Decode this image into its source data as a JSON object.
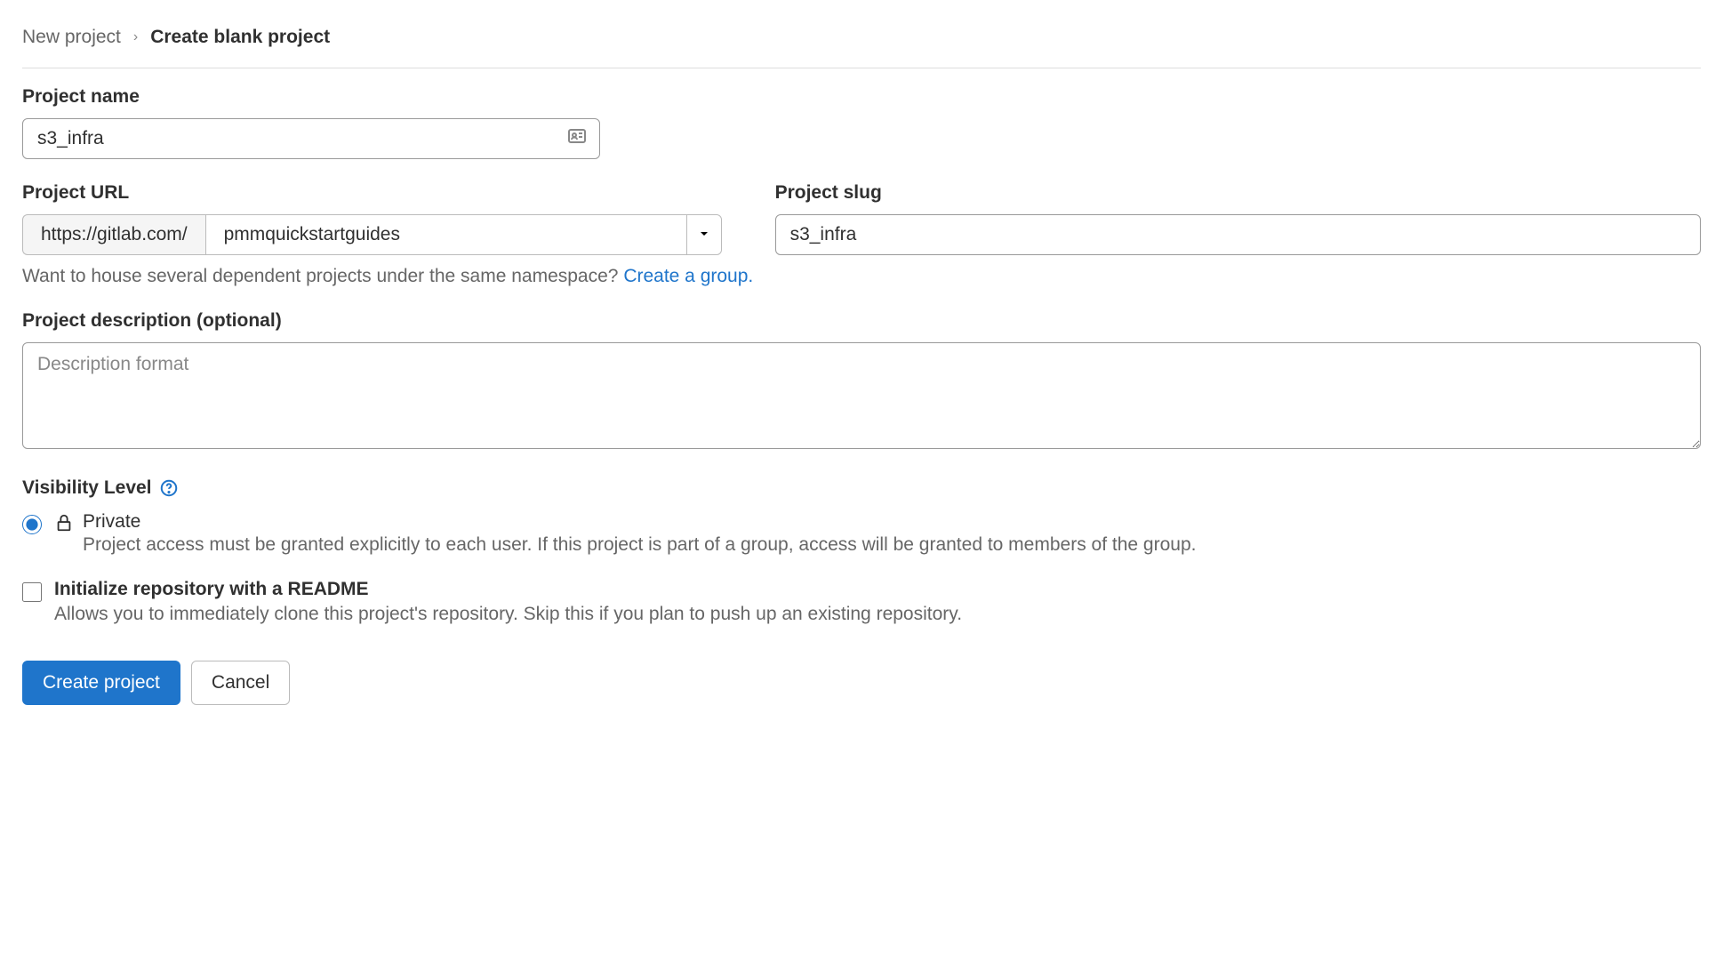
{
  "breadcrumb": {
    "parent": "New project",
    "separator": "›",
    "current": "Create blank project"
  },
  "projectName": {
    "label": "Project name",
    "value": "s3_infra"
  },
  "projectUrl": {
    "label": "Project URL",
    "prefix": "https://gitlab.com/",
    "namespace": "pmmquickstartguides"
  },
  "projectSlug": {
    "label": "Project slug",
    "value": "s3_infra"
  },
  "namespaceHelper": {
    "text": "Want to house several dependent projects under the same namespace? ",
    "linkText": "Create a group."
  },
  "description": {
    "label": "Project description (optional)",
    "placeholder": "Description format"
  },
  "visibility": {
    "label": "Visibility Level",
    "private": {
      "title": "Private",
      "desc": "Project access must be granted explicitly to each user. If this project is part of a group, access will be granted to members of the group."
    }
  },
  "readme": {
    "title": "Initialize repository with a README",
    "desc": "Allows you to immediately clone this project's repository. Skip this if you plan to push up an existing repository."
  },
  "buttons": {
    "create": "Create project",
    "cancel": "Cancel"
  }
}
